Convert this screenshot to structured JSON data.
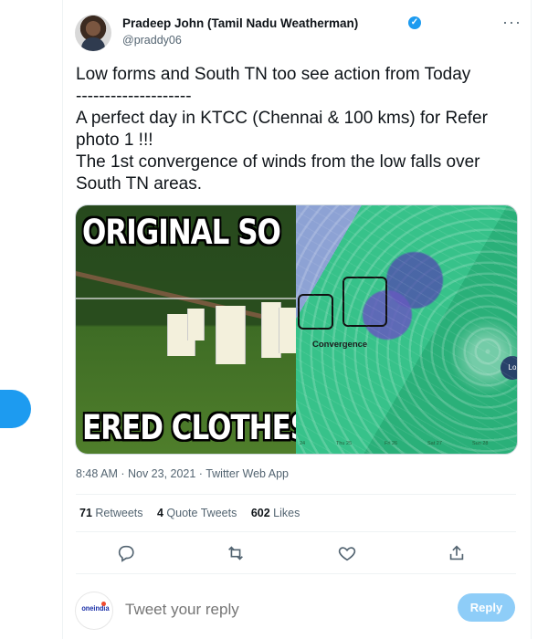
{
  "author": {
    "display_name": "Pradeep John (Tamil Nadu Weatherman)",
    "handle": "@praddy06",
    "verified_badge": "✓"
  },
  "tweet": {
    "lines": [
      "Low forms and South TN too see action from Today",
      "--------------------",
      "A perfect day in KTCC (Chennai & 100 kms) for Refer photo 1 !!!",
      "The 1st convergence of winds from the low falls over South TN areas."
    ],
    "more_label": "···"
  },
  "media": {
    "meme_top": "ORIGINAL SO",
    "meme_bottom": "ERED CLOTHES D",
    "map_label": "Convergence",
    "map_times": [
      "24",
      "Thu 25",
      "Fri 26",
      "Sat 27",
      "Sun 28"
    ],
    "side_label": "Lo"
  },
  "meta": {
    "timestamp": "8:48 AM · Nov 23, 2021 · Twitter Web App"
  },
  "stats": {
    "retweets": "71",
    "retweets_label": "Retweets",
    "quote_tweets": "4",
    "quote_tweets_label": "Quote Tweets",
    "likes": "602",
    "likes_label": "Likes"
  },
  "actions": [
    "reply-icon",
    "retweet-icon",
    "like-icon",
    "share-icon"
  ],
  "reply": {
    "avatar_text": "oneindia",
    "placeholder": "Tweet your reply",
    "button_label": "Reply"
  },
  "colors": {
    "accent": "#1d9bf0",
    "reply_disabled": "#8ecdf8",
    "muted": "#536471"
  }
}
